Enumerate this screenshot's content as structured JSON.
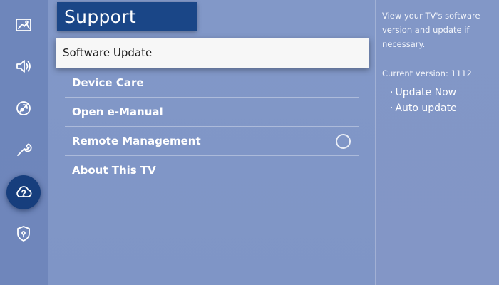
{
  "rail": {
    "items": [
      {
        "icon": "picture-icon",
        "active": false
      },
      {
        "icon": "sound-icon",
        "active": false
      },
      {
        "icon": "broadcasting-icon",
        "active": false
      },
      {
        "icon": "wrench-icon",
        "active": false
      },
      {
        "icon": "support-cloud-icon",
        "active": true
      },
      {
        "icon": "shield-icon",
        "active": false
      }
    ]
  },
  "menu": {
    "title": "Support",
    "focused_item": "Software Update",
    "items": [
      "Device Care",
      "Open e-Manual",
      "Remote Management",
      "About This TV"
    ],
    "remote_management_toggle": "off"
  },
  "info": {
    "description": "View your TV's software version and update if necessary.",
    "current_version": "Current version: 1112",
    "options": [
      "Update Now",
      "Auto update"
    ]
  },
  "colors": {
    "accent": "#1a4687",
    "background": "#7f95c6",
    "focus": "#f7f7f7"
  }
}
